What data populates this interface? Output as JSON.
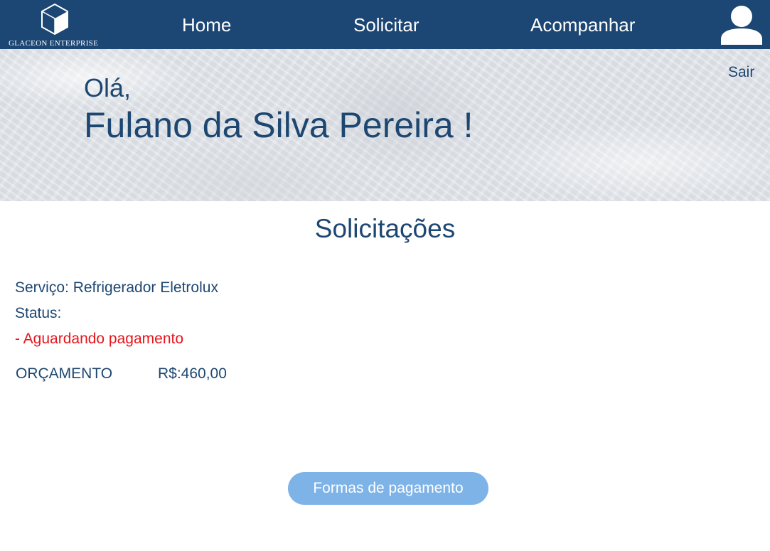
{
  "header": {
    "logo_text": "GLACEON ENTERPRISE",
    "nav": {
      "home": "Home",
      "solicitar": "Solicitar",
      "acompanhar": "Acompanhar"
    },
    "avatar_icon": "user-avatar-icon"
  },
  "hero": {
    "greeting": "Olá,",
    "user_name": "Fulano da Silva Pereira !",
    "logout_label": "Sair"
  },
  "main": {
    "title": "Solicitações",
    "service_line": "Serviço: Refrigerador Eletrolux",
    "status_label": "Status:",
    "status_value": "- Aguardando pagamento",
    "budget_label": "ORÇAMENTO",
    "budget_value": "R$:460,00",
    "payment_button": "Formas de pagamento"
  },
  "colors": {
    "header_bg": "#1c4673",
    "text_primary": "#1d4771",
    "status_alert": "#e8141b",
    "button_bg": "#7eb3e8"
  }
}
